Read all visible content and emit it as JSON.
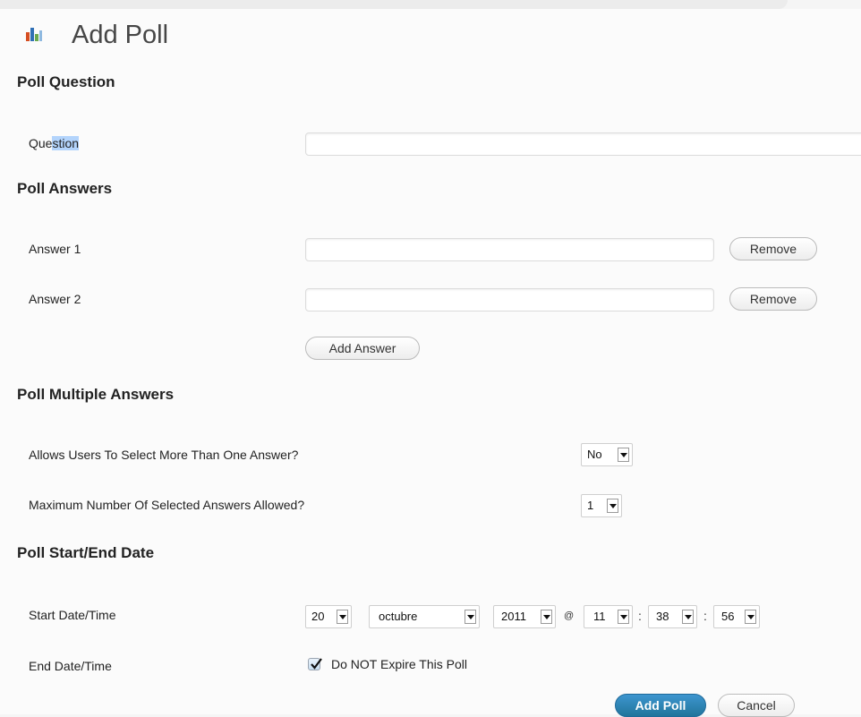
{
  "header": {
    "title": "Add Poll",
    "icon": "bar-chart-icon"
  },
  "question_section": {
    "heading": "Poll Question",
    "label_prefix": "Que",
    "label_selected": "stion",
    "input_value": ""
  },
  "answers_section": {
    "heading": "Poll Answers",
    "answers": [
      {
        "label": "Answer 1",
        "value": "",
        "remove_label": "Remove"
      },
      {
        "label": "Answer 2",
        "value": "",
        "remove_label": "Remove"
      }
    ],
    "add_answer_label": "Add Answer"
  },
  "multiple_section": {
    "heading": "Poll Multiple Answers",
    "allow_label": "Allows Users To Select More Than One Answer?",
    "allow_value": "No",
    "max_label": "Maximum Number Of Selected Answers Allowed?",
    "max_value": "1"
  },
  "date_section": {
    "heading": "Poll Start/End Date",
    "start_label": "Start Date/Time",
    "day": "20",
    "month": "octubre",
    "year": "2011",
    "at": "@",
    "hour": "11",
    "minute": "38",
    "second": "56",
    "colon": ":",
    "end_label": "End Date/Time",
    "no_expire_label": "Do NOT Expire This Poll",
    "no_expire_checked": true
  },
  "actions": {
    "add_poll_label": "Add Poll",
    "cancel_label": "Cancel"
  },
  "colors": {
    "primary_button": "#21759b",
    "selection_highlight": "#b3d4fc"
  }
}
